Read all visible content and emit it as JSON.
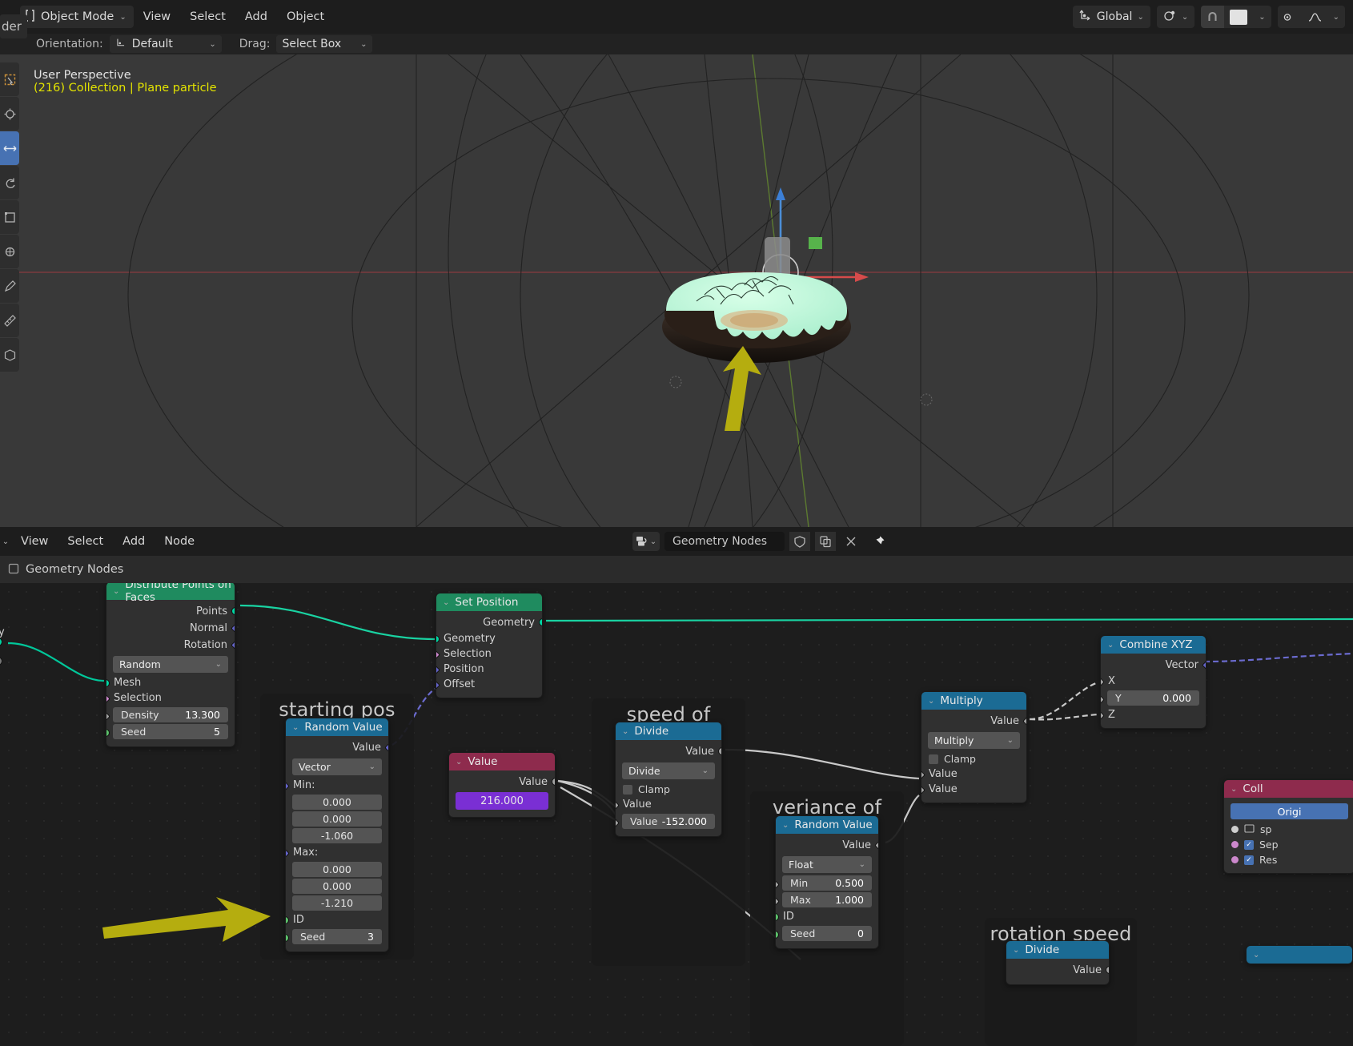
{
  "viewport_header": {
    "tooltip_fragment": "der",
    "mode": "Object Mode",
    "menus": [
      "View",
      "Select",
      "Add",
      "Object"
    ],
    "orientation_value": "Global",
    "snap_icon": "magnet-icon",
    "proportional_icon": "proportional-edit-icon"
  },
  "tool_settings": {
    "orientation_label": "Orientation:",
    "orientation_value": "Default",
    "drag_label": "Drag:",
    "drag_value": "Select Box"
  },
  "viewport": {
    "perspective": "User Perspective",
    "collection": "(216) Collection | Plane particle"
  },
  "node_editor_header": {
    "menus": [
      "View",
      "Select",
      "Add",
      "Node"
    ],
    "editor_type_icon": "geometry-nodes-icon",
    "datablock_name": "Geometry Nodes",
    "shield_icon": "fake-user-icon",
    "copy_icon": "new-datablock-icon",
    "close_icon": "unlink-icon",
    "pin_icon": "pin-icon"
  },
  "breadcrumb": {
    "icon": "modifier-icon",
    "label": "Geometry Nodes"
  },
  "frames": [
    {
      "label": "starting pos"
    },
    {
      "label": "speed of animation"
    },
    {
      "label": "veriance of speed"
    },
    {
      "label": "rotation speed"
    }
  ],
  "nodes": {
    "distribute": {
      "title": "Distribute Points on Faces",
      "outputs": [
        "Points",
        "Normal",
        "Rotation"
      ],
      "method": "Random",
      "inputs": [
        "Mesh",
        "Selection"
      ],
      "density_label": "Density",
      "density_value": "13.300",
      "seed_label": "Seed",
      "seed_value": "5"
    },
    "set_position": {
      "title": "Set Position",
      "outputs": [
        "Geometry"
      ],
      "inputs": [
        "Geometry",
        "Selection",
        "Position",
        "Offset"
      ]
    },
    "starting_pos_random": {
      "title": "Random Value",
      "output": "Value",
      "data_type": "Vector",
      "min_label": "Min:",
      "min_values": [
        "0.000",
        "0.000",
        "-1.060"
      ],
      "max_label": "Max:",
      "max_values": [
        "0.000",
        "0.000",
        "-1.210"
      ],
      "id_label": "ID",
      "seed_label": "Seed",
      "seed_value": "3"
    },
    "value_node": {
      "title": "Value",
      "output": "Value",
      "value": "216.000"
    },
    "divide_speed": {
      "title": "Divide",
      "output": "Value",
      "operation": "Divide",
      "clamp_label": "Clamp",
      "input_a_label": "Value",
      "input_b_label": "Value",
      "input_b_value": "-152.000"
    },
    "variance_random": {
      "title": "Random Value",
      "output": "Value",
      "data_type": "Float",
      "min_label": "Min",
      "min_value": "0.500",
      "max_label": "Max",
      "max_value": "1.000",
      "id_label": "ID",
      "seed_label": "Seed",
      "seed_value": "0"
    },
    "multiply": {
      "title": "Multiply",
      "output": "Value",
      "operation": "Multiply",
      "clamp_label": "Clamp",
      "input_a_label": "Value",
      "input_b_label": "Value"
    },
    "combine_xyz": {
      "title": "Combine XYZ",
      "output": "Vector",
      "x_label": "X",
      "y_label": "Y",
      "y_value": "0.000",
      "z_label": "Z"
    },
    "collection_info": {
      "title": "Coll",
      "button": "Origi",
      "rows": [
        "sp",
        "Sep",
        "Res"
      ]
    },
    "rotation_divide": {
      "title": "Divide",
      "output": "Value"
    }
  }
}
